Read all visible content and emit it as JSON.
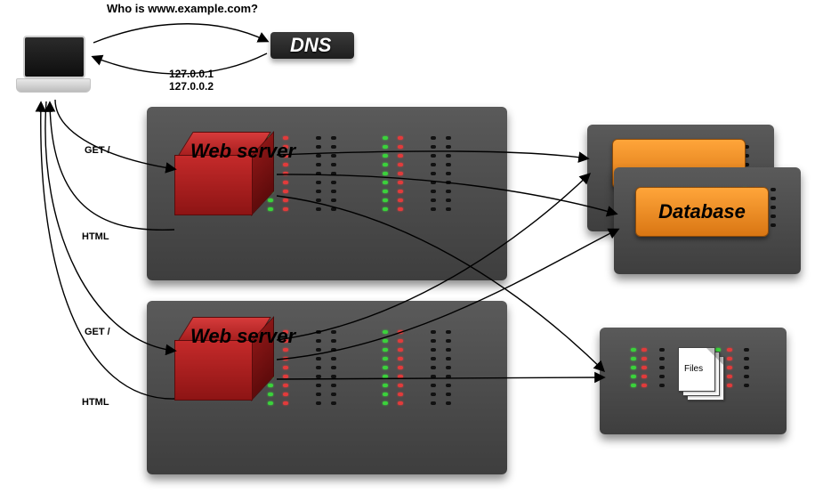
{
  "diagram": {
    "question": "Who is www.example.com?",
    "dns_label": "DNS",
    "ip_list": "127.0.0.1\n127.0.0.2",
    "request1": "GET /",
    "response1": "HTML",
    "request2": "GET /",
    "response2": "HTML",
    "web_server_label": "Web\nserver",
    "database_label": "Database",
    "files_label": "Files"
  },
  "nodes": {
    "client": {
      "type": "laptop"
    },
    "dns": {
      "type": "dns-server",
      "label_key": "dns_label"
    },
    "web_server_1": {
      "type": "app-server",
      "label_key": "web_server_label"
    },
    "web_server_2": {
      "type": "app-server",
      "label_key": "web_server_label"
    },
    "database_1": {
      "type": "db-server",
      "label_key": "database_label"
    },
    "database_2": {
      "type": "db-server",
      "label_key": "database_label"
    },
    "file_server": {
      "type": "file-server",
      "label_key": "files_label"
    }
  },
  "edges": [
    {
      "from": "client",
      "to": "dns",
      "label_key": "question"
    },
    {
      "from": "dns",
      "to": "client",
      "label_key": "ip_list"
    },
    {
      "from": "client",
      "to": "web_server_1",
      "label_key": "request1"
    },
    {
      "from": "web_server_1",
      "to": "client",
      "label_key": "response1"
    },
    {
      "from": "client",
      "to": "web_server_2",
      "label_key": "request2"
    },
    {
      "from": "web_server_2",
      "to": "client",
      "label_key": "response2"
    },
    {
      "from": "web_server_1",
      "to": "database_1"
    },
    {
      "from": "web_server_1",
      "to": "database_2"
    },
    {
      "from": "web_server_1",
      "to": "file_server"
    },
    {
      "from": "web_server_2",
      "to": "database_1"
    },
    {
      "from": "web_server_2",
      "to": "database_2"
    },
    {
      "from": "web_server_2",
      "to": "file_server"
    }
  ]
}
